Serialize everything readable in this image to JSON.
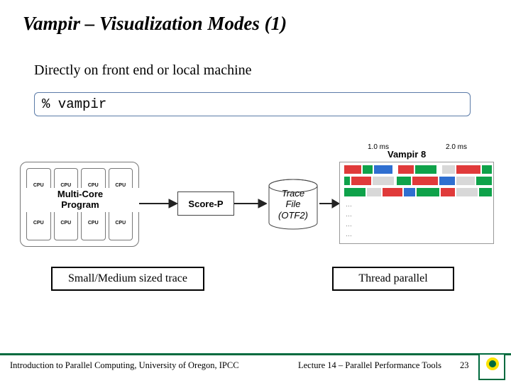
{
  "title": "Vampir – Visualization Modes (1)",
  "subtitle": "Directly on front end or local machine",
  "command": "% vampir",
  "cpu_label": "CPU",
  "multicore_label_l1": "Multi-Core",
  "multicore_label_l2": "Program",
  "scorep_label": "Score-P",
  "trace_l1": "Trace",
  "trace_l2": "File",
  "trace_l3": "(OTF2)",
  "vampir8_label": "Vampir 8",
  "ticks": {
    "t1": "1.0 ms",
    "t2": "2.0 ms"
  },
  "colors": {
    "green": "#0fa24a",
    "red": "#e03a3a",
    "blue": "#2f6fd0",
    "pale": "#d8d8d8"
  },
  "timeline_rows": [
    [
      {
        "l": 2,
        "w": 24,
        "c": "red"
      },
      {
        "l": 28,
        "w": 14,
        "c": "green"
      },
      {
        "l": 44,
        "w": 26,
        "c": "blue"
      },
      {
        "l": 78,
        "w": 22,
        "c": "red"
      },
      {
        "l": 102,
        "w": 30,
        "c": "green"
      },
      {
        "l": 140,
        "w": 18,
        "c": "pale"
      },
      {
        "l": 160,
        "w": 34,
        "c": "red"
      },
      {
        "l": 196,
        "w": 14,
        "c": "green"
      }
    ],
    [
      {
        "l": 2,
        "w": 8,
        "c": "green"
      },
      {
        "l": 12,
        "w": 28,
        "c": "red"
      },
      {
        "l": 42,
        "w": 30,
        "c": "pale"
      },
      {
        "l": 76,
        "w": 20,
        "c": "green"
      },
      {
        "l": 98,
        "w": 36,
        "c": "red"
      },
      {
        "l": 136,
        "w": 22,
        "c": "blue"
      },
      {
        "l": 160,
        "w": 26,
        "c": "pale"
      },
      {
        "l": 188,
        "w": 22,
        "c": "green"
      }
    ],
    [
      {
        "l": 2,
        "w": 30,
        "c": "green"
      },
      {
        "l": 34,
        "w": 20,
        "c": "pale"
      },
      {
        "l": 56,
        "w": 28,
        "c": "red"
      },
      {
        "l": 86,
        "w": 16,
        "c": "blue"
      },
      {
        "l": 104,
        "w": 32,
        "c": "green"
      },
      {
        "l": 138,
        "w": 20,
        "c": "red"
      },
      {
        "l": 160,
        "w": 30,
        "c": "pale"
      },
      {
        "l": 192,
        "w": 18,
        "c": "green"
      }
    ]
  ],
  "small_box": "Small/Medium sized trace",
  "thread_box": "Thread parallel",
  "footer_left": "Introduction to Parallel Computing, University of Oregon, IPCC",
  "footer_mid": "Lecture 14 – Parallel Performance Tools",
  "page_num": "23"
}
